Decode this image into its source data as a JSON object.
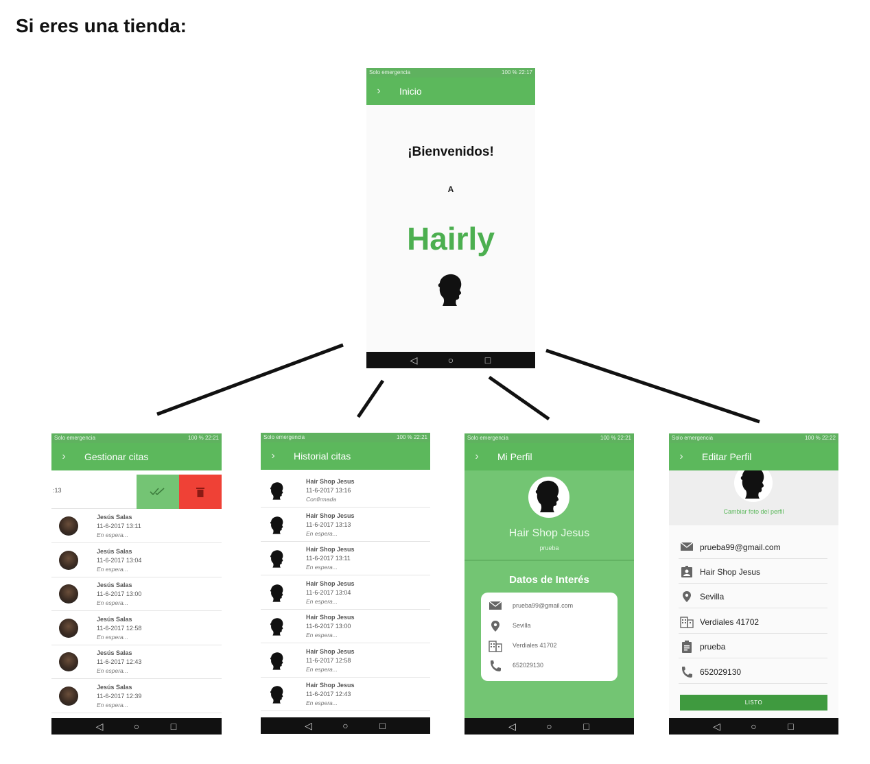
{
  "heading": "Si eres una tienda:",
  "status_common": {
    "left": "Solo emergencia",
    "battery": "100 %"
  },
  "home": {
    "status_time": "22:17",
    "title": "Inicio",
    "welcome": "¡Bienvenidos!",
    "a": "A",
    "brand": "Hairly",
    "brand_color": "#4caf50"
  },
  "gestionar": {
    "status_time": "22:21",
    "title": "Gestionar citas",
    "swipe_time": ":13",
    "rows": [
      {
        "name": "Jesús Salas",
        "date": "11-6-2017 13:11",
        "status": "En espera..."
      },
      {
        "name": "Jesús Salas",
        "date": "11-6-2017 13:04",
        "status": "En espera..."
      },
      {
        "name": "Jesús Salas",
        "date": "11-6-2017 13:00",
        "status": "En espera..."
      },
      {
        "name": "Jesús Salas",
        "date": "11-6-2017 12:58",
        "status": "En espera..."
      },
      {
        "name": "Jesús Salas",
        "date": "11-6-2017 12:43",
        "status": "En espera..."
      },
      {
        "name": "Jesús Salas",
        "date": "11-6-2017 12:39",
        "status": "En espera..."
      }
    ]
  },
  "historial": {
    "status_time": "22:21",
    "title": "Historial citas",
    "rows": [
      {
        "name": "Hair Shop Jesus",
        "date": "11-6-2017 13:16",
        "status": "Confirmada"
      },
      {
        "name": "Hair Shop Jesus",
        "date": "11-6-2017 13:13",
        "status": "En espera..."
      },
      {
        "name": "Hair Shop Jesus",
        "date": "11-6-2017 13:11",
        "status": "En espera..."
      },
      {
        "name": "Hair Shop Jesus",
        "date": "11-6-2017 13:04",
        "status": "En espera..."
      },
      {
        "name": "Hair Shop Jesus",
        "date": "11-6-2017 13:00",
        "status": "En espera..."
      },
      {
        "name": "Hair Shop Jesus",
        "date": "11-6-2017 12:58",
        "status": "En espera..."
      },
      {
        "name": "Hair Shop Jesus",
        "date": "11-6-2017 12:43",
        "status": "En espera..."
      }
    ]
  },
  "perfil": {
    "status_time": "22:21",
    "title": "Mi Perfil",
    "name": "Hair Shop Jesus",
    "sub": "prueba",
    "section": "Datos de Interés",
    "email": "prueba99@gmail.com",
    "city": "Sevilla",
    "address": "Verdiales 41702",
    "phone": "652029130"
  },
  "editar": {
    "status_time": "22:22",
    "title": "Editar Perfil",
    "change_photo": "Cambiar foto del perfil",
    "email": "prueba99@gmail.com",
    "name": "Hair Shop Jesus",
    "city": "Sevilla",
    "address": "Verdiales 41702",
    "sub": "prueba",
    "phone": "652029130",
    "done": "LISTO"
  },
  "nav_icons": [
    "back-icon",
    "home-icon",
    "recents-icon"
  ]
}
